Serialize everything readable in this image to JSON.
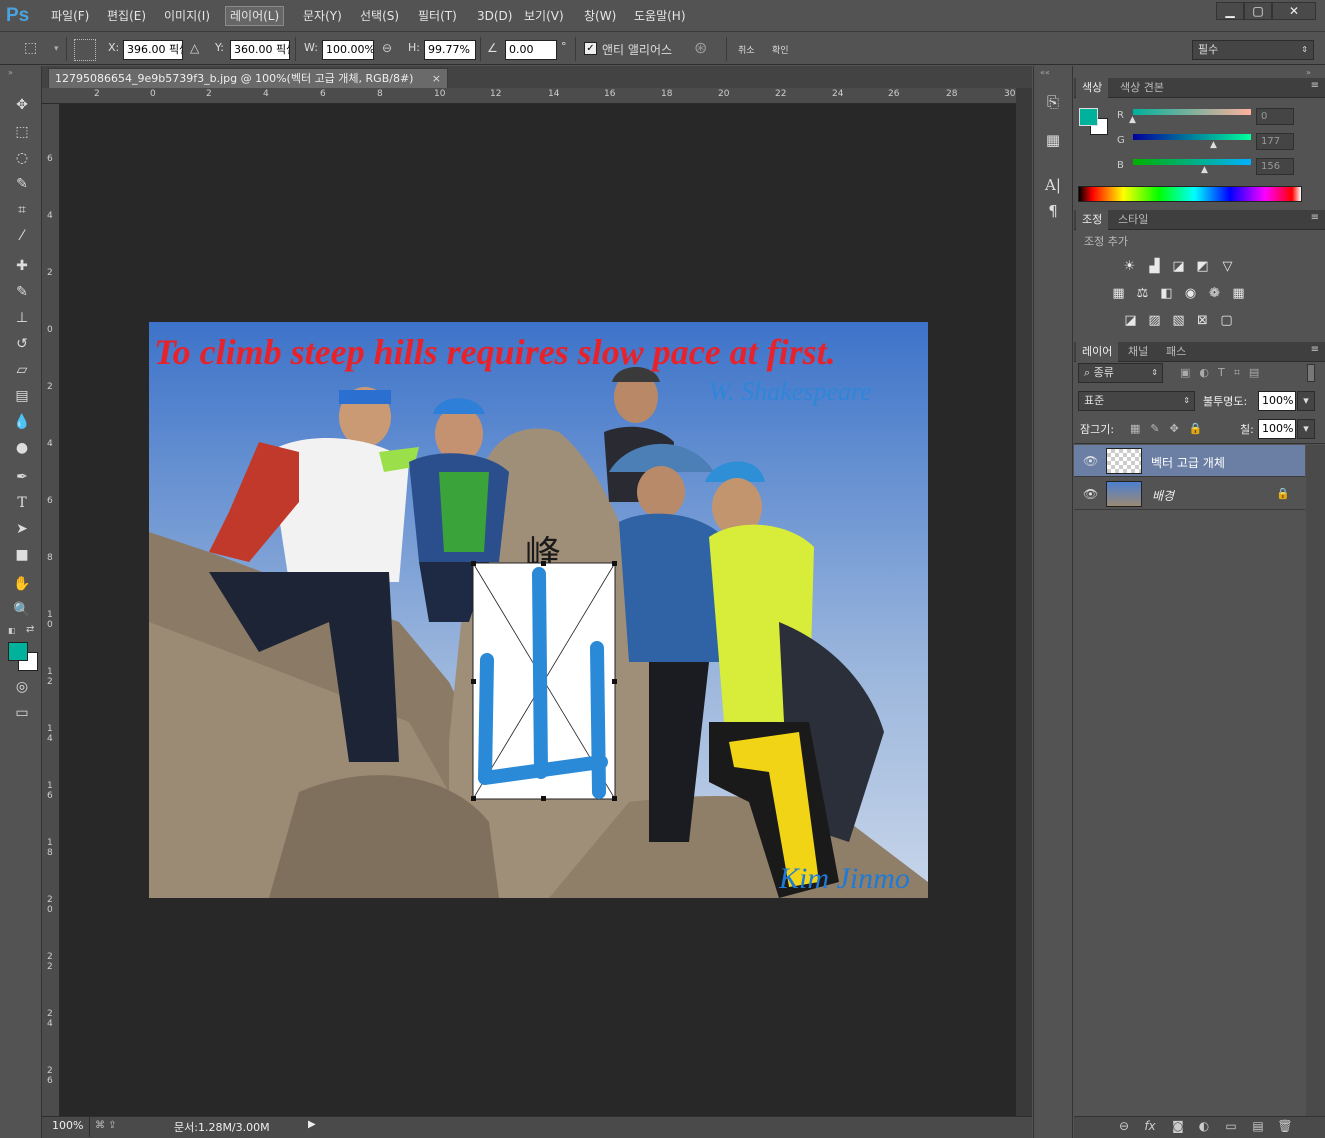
{
  "app": {
    "logo": "Ps"
  },
  "menubar": {
    "items": [
      "파일(F)",
      "편집(E)",
      "이미지(I)",
      "레이어(L)",
      "문자(Y)",
      "선택(S)",
      "필터(T)",
      "3D(D)",
      "보기(V)",
      "창(W)",
      "도움말(H)"
    ],
    "active_index": 3,
    "window_buttons": {
      "minimize": "▁",
      "restore": "▢",
      "close": "✕"
    }
  },
  "options": {
    "x_label": "X:",
    "x_value": "396.00 픽셀",
    "y_label": "Y:",
    "y_value": "360.00 픽셀",
    "w_label": "W:",
    "w_value": "100.00%",
    "h_label": "H:",
    "h_value": "99.77%",
    "angle_value": "0.00",
    "angle_unit": "°",
    "antialias_label": "앤티 앨리어스",
    "antialias_checked": true,
    "cancel_label": "취소",
    "commit_label": "확인",
    "workspace": "필수"
  },
  "document": {
    "tab_title": "12795086654_9e9b5739f3_b.jpg @ 100%(벡터 고급 개체, RGB/8#)",
    "close_glyph": "×",
    "ruler_top": [
      "2",
      "0",
      "2",
      "4",
      "6",
      "8",
      "10",
      "12",
      "14",
      "16",
      "18",
      "20",
      "22",
      "24",
      "26",
      "28",
      "30"
    ],
    "ruler_left": [
      "6",
      "4",
      "2",
      "0",
      "2",
      "4",
      "6",
      "8",
      "1\n0",
      "1\n2",
      "1\n4",
      "1\n6",
      "1\n8",
      "2\n0",
      "2\n2",
      "2\n4",
      "2\n6"
    ],
    "photo_text": {
      "quote": "To climb steep hills requires slow pace at first.",
      "author": "W. Shakespeare",
      "signature": "Kim Jinmo",
      "stone_char": "峰",
      "smart_object_char": "山"
    }
  },
  "status": {
    "zoom": "100%",
    "doc_info": "문서:1.28M/3.00M"
  },
  "color_panel": {
    "tabs": [
      "색상",
      "색상 견본"
    ],
    "fg_color": "#00b19c",
    "bg_color": "#ffffff",
    "r_label": "R",
    "r_value": "0",
    "g_label": "G",
    "g_value": "177",
    "b_label": "B",
    "b_value": "156"
  },
  "adjust_panel": {
    "tabs": [
      "조정",
      "스타일"
    ],
    "add_label": "조정 추가",
    "row1": [
      "brightness-icon",
      "levels-icon",
      "curves-icon",
      "exposure-icon",
      "vibrance-icon"
    ],
    "row2": [
      "hue-saturation-icon",
      "color-balance-icon",
      "black-white-icon",
      "photo-filter-icon",
      "channel-mixer-icon",
      "color-lookup-icon"
    ],
    "row3": [
      "invert-icon",
      "posterize-icon",
      "threshold-icon",
      "gradient-map-icon",
      "selective-color-icon"
    ]
  },
  "layers_panel": {
    "tabs": [
      "레이어",
      "채널",
      "패스"
    ],
    "filter_kind": "종류",
    "blend_mode": "표준",
    "opacity_label": "불투명도:",
    "opacity_value": "100%",
    "lock_label": "잠그기:",
    "fill_label": "칠:",
    "fill_value": "100%",
    "layers": [
      {
        "name": "벡터 고급 개체",
        "selected": true,
        "locked": false
      },
      {
        "name": "배경",
        "selected": false,
        "locked": true
      }
    ]
  }
}
